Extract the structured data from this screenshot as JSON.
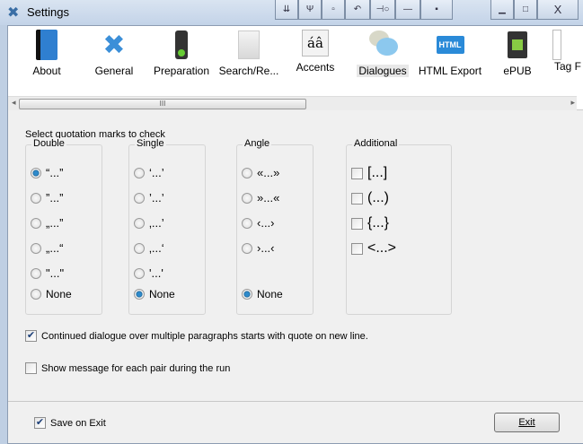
{
  "window": {
    "title": "Settings"
  },
  "toolbar": {
    "items": [
      {
        "label": "About",
        "icon": "book-icon"
      },
      {
        "label": "General",
        "icon": "tools-icon"
      },
      {
        "label": "Preparation",
        "icon": "traffic-light-icon"
      },
      {
        "label": "Search/Re...",
        "icon": "search-replace-icon"
      },
      {
        "label": "Accents",
        "icon": "accents-icon",
        "glyph": "áâ"
      },
      {
        "label": "Dialogues",
        "icon": "speech-bubbles-icon"
      },
      {
        "label": "HTML Export",
        "icon": "html-export-icon",
        "glyph": "HTML"
      },
      {
        "label": "ePUB",
        "icon": "epub-icon"
      },
      {
        "label": "Tag F",
        "icon": "tag-icon"
      }
    ],
    "selected": "Dialogues",
    "scroll_grip": "III"
  },
  "main": {
    "heading": "Select quotation marks to check",
    "double": {
      "label": "Double",
      "options": [
        "“...”",
        "”...”",
        "„...”",
        "„...“",
        "\"...\"",
        "None"
      ],
      "selected": 0
    },
    "single": {
      "label": "Single",
      "options": [
        "‘...’",
        "’...’",
        "‚...’",
        "‚...‘",
        "'...'",
        "None"
      ],
      "selected": 5
    },
    "angle": {
      "label": "Angle",
      "options": [
        "«...»",
        "»...«",
        "‹...›",
        "›...‹",
        "None"
      ],
      "selected": 4
    },
    "additional": {
      "label": "Additional",
      "options": [
        "[...]",
        "(...)",
        "{...}",
        "<...>"
      ],
      "checked": [
        false,
        false,
        false,
        false
      ]
    },
    "continued": {
      "label": "Continued dialogue over multiple paragraphs starts with quote on new line.",
      "checked": true
    },
    "show_message": {
      "label": "Show message for each pair during the run",
      "checked": false
    }
  },
  "footer": {
    "save_on_exit": {
      "label": "Save on Exit",
      "checked": true
    },
    "exit_label": "Exit"
  }
}
